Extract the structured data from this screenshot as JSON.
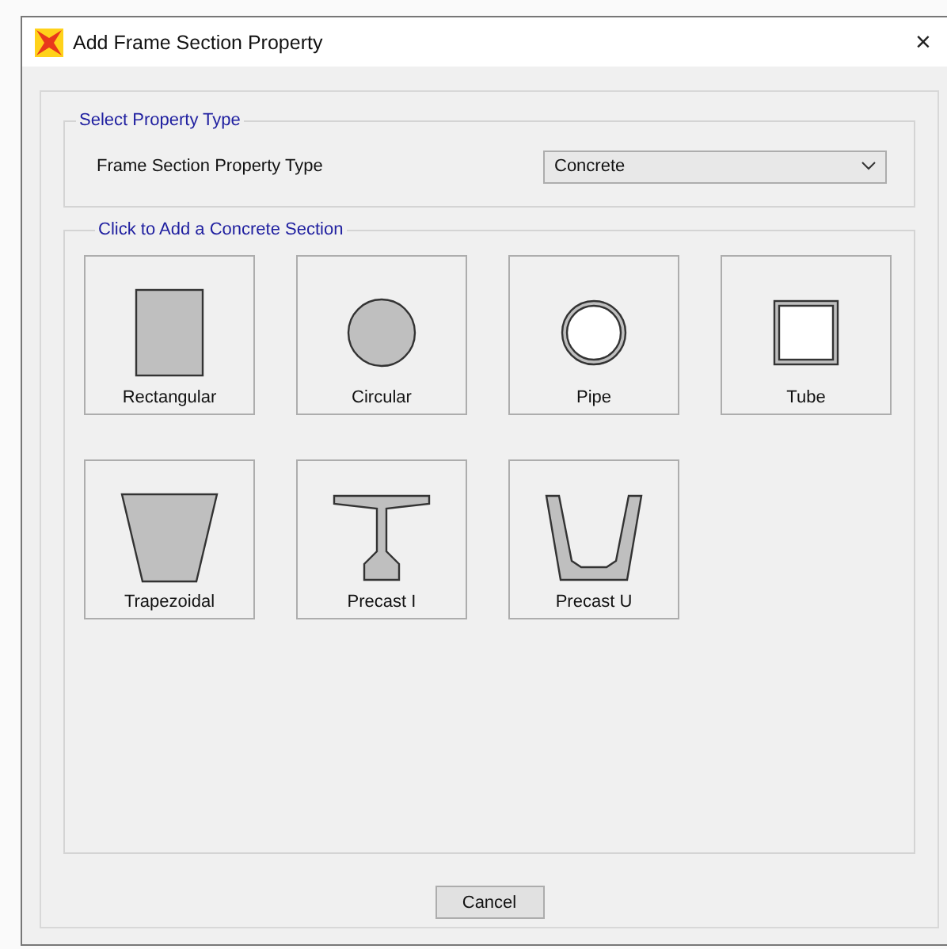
{
  "window": {
    "title": "Add Frame Section Property",
    "close": "×"
  },
  "property_type": {
    "group_title": "Select Property Type",
    "label": "Frame Section Property Type",
    "value": "Concrete"
  },
  "sections": {
    "group_title": "Click to Add a Concrete Section",
    "items": [
      {
        "kind": "rectangular",
        "label": "Rectangular"
      },
      {
        "kind": "circular",
        "label": "Circular"
      },
      {
        "kind": "pipe",
        "label": "Pipe"
      },
      {
        "kind": "tube",
        "label": "Tube"
      },
      {
        "kind": "trapezoidal",
        "label": "Trapezoidal"
      },
      {
        "kind": "precast_i",
        "label": "Precast I"
      },
      {
        "kind": "precast_u",
        "label": "Precast U"
      }
    ]
  },
  "buttons": [
    "Cancel"
  ]
}
